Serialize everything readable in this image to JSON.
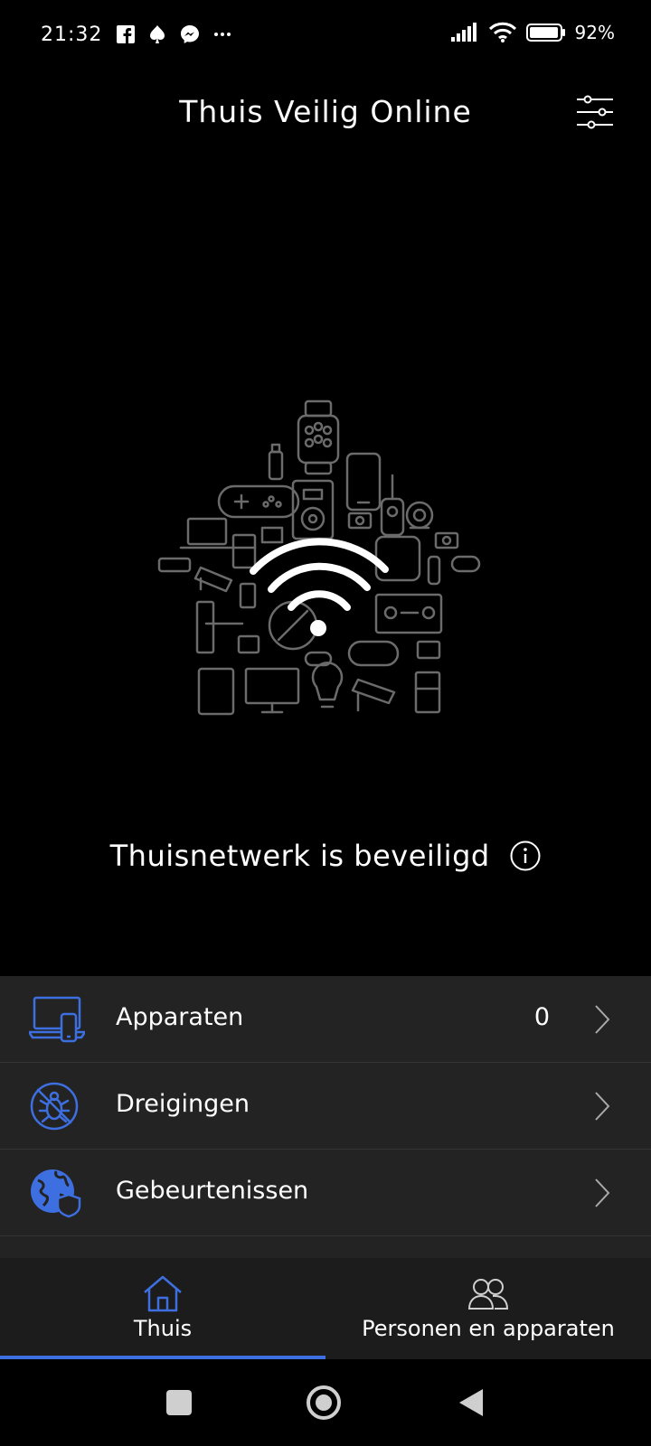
{
  "status_bar": {
    "time": "21:32",
    "battery": "92%",
    "notification_icons": [
      "facebook-icon",
      "spade-icon",
      "messenger-icon",
      "more-icon"
    ]
  },
  "header": {
    "title": "Thuis Veilig Online"
  },
  "hero": {
    "status_text": "Thuisnetwerk is beveiligd"
  },
  "list": {
    "items": [
      {
        "label": "Apparaten",
        "count": "0",
        "icon": "devices-icon"
      },
      {
        "label": "Dreigingen",
        "count": "",
        "icon": "no-bug-icon"
      },
      {
        "label": "Gebeurtenissen",
        "count": "",
        "icon": "globe-shield-icon"
      }
    ]
  },
  "bottom_nav": {
    "tabs": [
      {
        "label": "Thuis",
        "icon": "home-icon",
        "active": true
      },
      {
        "label": "Personen en apparaten",
        "icon": "people-icon",
        "active": false
      }
    ]
  },
  "colors": {
    "accent": "#3d6fe0",
    "background": "#000000",
    "list_background": "#232323",
    "nav_background": "#1c1c1c"
  }
}
